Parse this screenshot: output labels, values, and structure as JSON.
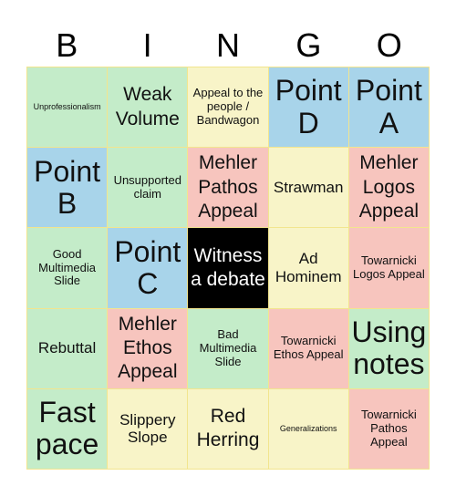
{
  "header": {
    "letters": [
      "B",
      "I",
      "N",
      "G",
      "O"
    ]
  },
  "colors": {
    "green": "#C4ECC9",
    "yellow": "#F8F4C8",
    "blue": "#A8D4EA",
    "pink": "#F7C5BE",
    "free": "#000000",
    "border": "#F2E58E"
  },
  "cells": [
    {
      "text": "Unprofessionalism",
      "color": "green"
    },
    {
      "text": "Weak Volume",
      "color": "green"
    },
    {
      "text": "Appeal to the people / Bandwagon",
      "color": "yellow"
    },
    {
      "text": "Point D",
      "color": "blue"
    },
    {
      "text": "Point A",
      "color": "blue"
    },
    {
      "text": "Point B",
      "color": "blue"
    },
    {
      "text": "Unsupported claim",
      "color": "green"
    },
    {
      "text": "Mehler Pathos Appeal",
      "color": "pink"
    },
    {
      "text": "Strawman",
      "color": "yellow"
    },
    {
      "text": "Mehler Logos Appeal",
      "color": "pink"
    },
    {
      "text": "Good Multimedia Slide",
      "color": "green"
    },
    {
      "text": "Point C",
      "color": "blue"
    },
    {
      "text": "Witness a debate",
      "color": "black"
    },
    {
      "text": "Ad Hominem",
      "color": "yellow"
    },
    {
      "text": "Towarnicki Logos Appeal",
      "color": "pink"
    },
    {
      "text": "Rebuttal",
      "color": "green"
    },
    {
      "text": "Mehler Ethos Appeal",
      "color": "pink"
    },
    {
      "text": "Bad Multimedia Slide",
      "color": "green"
    },
    {
      "text": "Towarnicki Ethos Appeal",
      "color": "pink"
    },
    {
      "text": "Using notes",
      "color": "green"
    },
    {
      "text": "Fast pace",
      "color": "green"
    },
    {
      "text": "Slippery Slope",
      "color": "yellow"
    },
    {
      "text": "Red Herring",
      "color": "yellow"
    },
    {
      "text": "Generalizations",
      "color": "yellow"
    },
    {
      "text": "Towarnicki Pathos Appeal",
      "color": "pink"
    }
  ]
}
